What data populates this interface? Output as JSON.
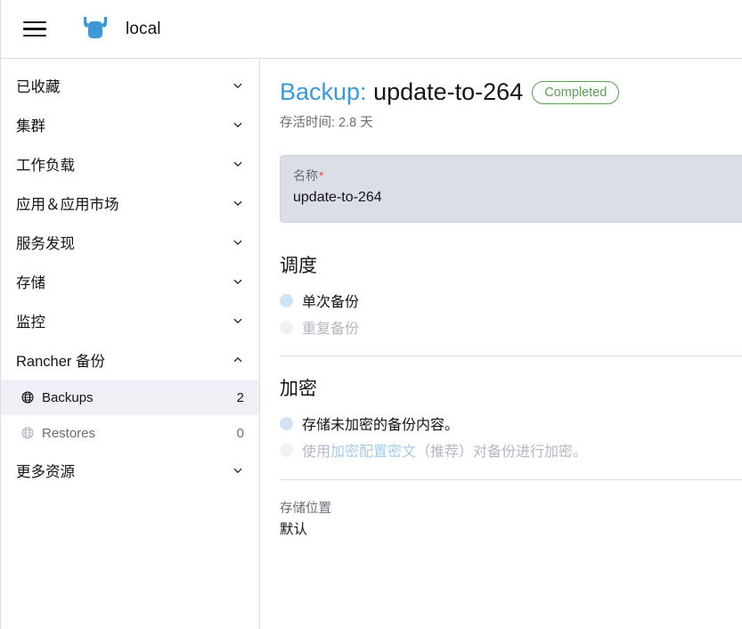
{
  "header": {
    "menu_icon": "hamburger-icon",
    "logo_icon": "rancher-cow-logo",
    "cluster_name": "local"
  },
  "colors": {
    "brand_blue": "#3d98d3",
    "status_green": "#5d9e57",
    "required_red": "#f64747",
    "active_nav_bg": "#eef0f6",
    "field_bg": "#dcdee7",
    "border": "#dcdee7",
    "muted_text": "#6c6c76"
  },
  "sidebar": {
    "groups": [
      {
        "label": "已收藏",
        "chevron": "chevron-down-icon",
        "expanded": false
      },
      {
        "label": "集群",
        "chevron": "chevron-down-icon",
        "expanded": false
      },
      {
        "label": "工作负载",
        "chevron": "chevron-down-icon",
        "expanded": false
      },
      {
        "label": "应用＆应用市场",
        "chevron": "chevron-down-icon",
        "expanded": false
      },
      {
        "label": "服务发现",
        "chevron": "chevron-down-icon",
        "expanded": false
      },
      {
        "label": "存储",
        "chevron": "chevron-down-icon",
        "expanded": false
      },
      {
        "label": "监控",
        "chevron": "chevron-down-icon",
        "expanded": false
      },
      {
        "label": "Rancher 备份",
        "chevron": "chevron-up-icon",
        "expanded": true
      }
    ],
    "children": [
      {
        "label": "Backups",
        "count": "2",
        "icon": "globe-icon",
        "active": true
      },
      {
        "label": "Restores",
        "count": "0",
        "icon": "globe-icon",
        "active": false
      }
    ],
    "more_resources": {
      "label": "更多资源",
      "chevron": "chevron-down-icon"
    }
  },
  "main": {
    "title_kind": "Backup:",
    "title_name": "update-to-264",
    "status_badge": "Completed",
    "subtitle": "存活时间: 2.8 天",
    "name_field": {
      "label": "名称",
      "required_mark": "*",
      "value": "update-to-264"
    },
    "schedule": {
      "heading": "调度",
      "options": [
        {
          "label": "单次备份",
          "selected": true,
          "disabled": false
        },
        {
          "label": "重复备份",
          "selected": false,
          "disabled": true
        }
      ]
    },
    "encryption": {
      "heading": "加密",
      "option_plain": "存储未加密的备份内容。",
      "option_encrypted_prefix": "使用",
      "option_encrypted_link": "加密配置密文",
      "option_encrypted_suffix": "（推荐）对备份进行加密。"
    },
    "storage": {
      "label": "存储位置",
      "value": "默认"
    }
  }
}
